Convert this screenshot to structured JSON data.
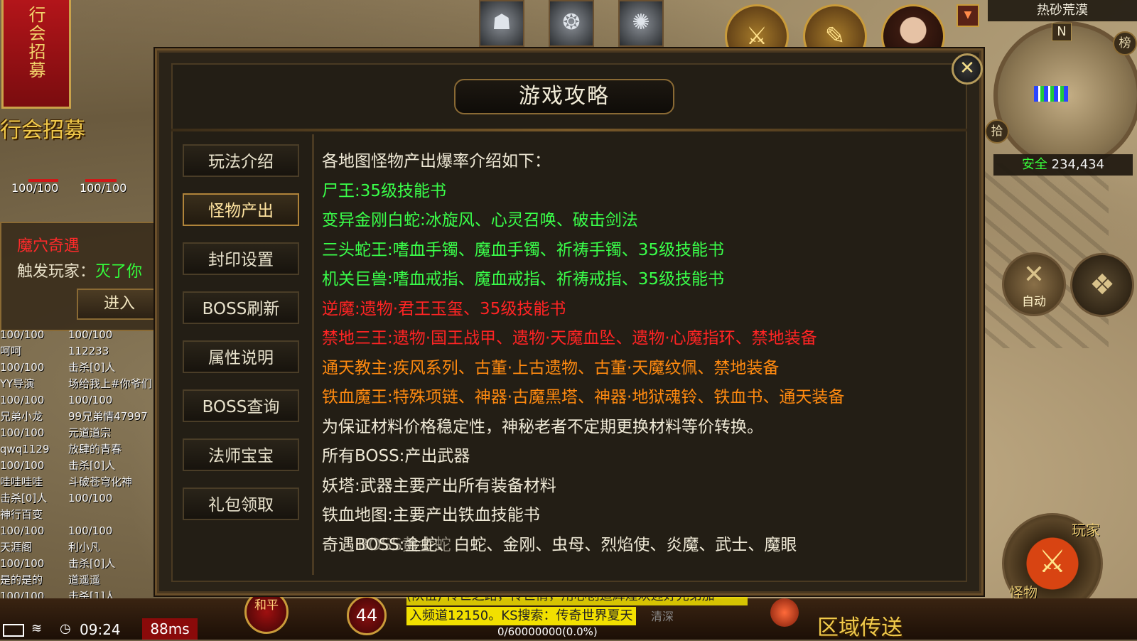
{
  "guild": {
    "banner": "行会招募",
    "label": "行会招募"
  },
  "event": {
    "title": "魔穴奇遇",
    "trigger_label": "触发玩家：",
    "trigger_name": "灭了你",
    "enter": "进入"
  },
  "hp_top": [
    "100/100",
    "100/100"
  ],
  "players": [
    [
      "100/100",
      "100/100"
    ],
    [
      "呵呵",
      "112233"
    ],
    [
      "100/100",
      "击杀[0]人"
    ],
    [
      "YY导演",
      "场给我上#你爷们"
    ],
    [
      "100/100",
      "100/100"
    ],
    [
      "兄弟小龙",
      "99兄弟情47997"
    ],
    [
      "100/100",
      "元道道宗"
    ],
    [
      "qwq1129",
      "放肆的青春"
    ],
    [
      "100/100",
      "击杀[0]人"
    ],
    [
      "哇哇哇哇",
      "斗破苍穹化神"
    ],
    [
      "击杀[0]人",
      "100/100"
    ],
    [
      "神行百变",
      ""
    ],
    [
      "100/100",
      "100/100"
    ],
    [
      "天涯阁",
      "利小凡"
    ],
    [
      "100/100",
      "击杀[0]人"
    ],
    [
      "是的是的",
      "道遥遥"
    ],
    [
      "100/100",
      "击杀[1]人"
    ]
  ],
  "skills": [
    "skill-icon-1",
    "skill-icon-2",
    "skill-icon-3"
  ],
  "minimap": {
    "map_name": "热砂荒漠",
    "compass": "N",
    "safe": "安全",
    "coords": "234,434",
    "side_buttons": [
      "榜",
      "拾"
    ]
  },
  "auto": {
    "label": "自动"
  },
  "attack": {
    "label1": "玩家",
    "label2": "怪物"
  },
  "bottom": {
    "peace": "和平",
    "level": "44",
    "chat1": "(队伍) 传世之路，传世情，用心创造辉煌欢迎好兄弟加",
    "chat2": "入频道12150。KS搜索：传奇世界夏天",
    "chat_tail": "清深",
    "exp": "0/60000000(0.0%)",
    "teleport": "区域传送",
    "time": "09:24",
    "ping": "88ms"
  },
  "dialog": {
    "title": "游戏攻略",
    "close": "✕",
    "tabs": [
      {
        "label": "玩法介绍",
        "active": false
      },
      {
        "label": "怪物产出",
        "active": true
      },
      {
        "label": "封印设置",
        "active": false
      },
      {
        "label": "BOSS刷新",
        "active": false
      },
      {
        "label": "属性说明",
        "active": false
      },
      {
        "label": "BOSS查询",
        "active": false
      },
      {
        "label": "法师宝宝",
        "active": false
      },
      {
        "label": "礼包领取",
        "active": false
      }
    ],
    "lines": [
      {
        "text": "各地图怪物产出爆率介绍如下：",
        "color": "white"
      },
      {
        "text": "尸王:35级技能书",
        "color": "green"
      },
      {
        "text": "变异金刚白蛇:冰旋风、心灵召唤、破击剑法",
        "color": "green"
      },
      {
        "text": "三头蛇王:嗜血手镯、魔血手镯、祈祷手镯、35级技能书",
        "color": "green"
      },
      {
        "text": "机关巨兽:嗜血戒指、魔血戒指、祈祷戒指、35级技能书",
        "color": "green"
      },
      {
        "text": "逆魔:遗物·君王玉玺、35级技能书",
        "color": "red"
      },
      {
        "text": "禁地三王:遗物·国王战甲、遗物·天魔血坠、遗物·心魔指环、禁地装备",
        "color": "red"
      },
      {
        "text": "通天教主:疾风系列、古董·上古遗物、古董·天魔纹佩、禁地装备",
        "color": "orange"
      },
      {
        "text": "铁血魔王:特殊项链、神器·古魔黑塔、神器·地狱魂铃、铁血书、通天装备",
        "color": "orange"
      },
      {
        "text": "为保证材料价格稳定性，神秘老者不定期更换材料等价转换。",
        "color": "white"
      },
      {
        "text": "所有BOSS:产出武器",
        "color": "white"
      },
      {
        "text": "妖塔:武器主要产出所有装备材料",
        "color": "white"
      },
      {
        "text": "铁血地图:主要产出铁血技能书",
        "color": "white"
      },
      {
        "text": "奇遇BOSS:金蛇、白蛇、金刚、虫母、烈焰使、炎魔、武士、魔眼",
        "color": "white",
        "overlay": "BOSS黄金蛇"
      }
    ]
  }
}
